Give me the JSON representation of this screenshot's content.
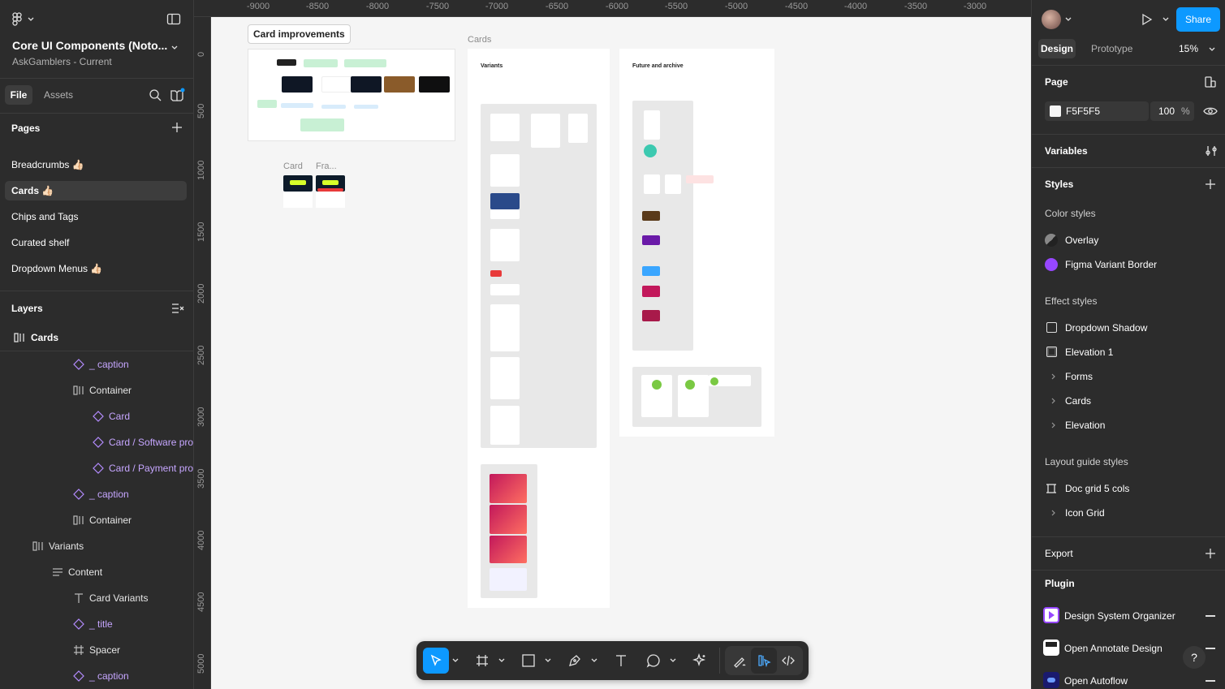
{
  "left_panel": {
    "file_name": "Core UI Components (Noto...",
    "project": "AskGamblers - Current",
    "tabs": {
      "file": "File",
      "assets": "Assets"
    },
    "pages_header": "Pages",
    "pages": [
      "Breadcrumbs 👍🏻",
      "Cards 👍🏻",
      "Chips and Tags",
      "Curated shelf",
      "Dropdown Menus 👍🏻"
    ],
    "layers_header": "Layers",
    "layers_root": "Cards",
    "layers": [
      {
        "label": "_ caption",
        "icon": "component-instance-icon",
        "purple": true
      },
      {
        "label": "Container",
        "icon": "frame-autolayout-icon",
        "purple": false
      },
      {
        "label": "Card",
        "icon": "component-instance-icon",
        "purple": true
      },
      {
        "label": "Card / Software pro",
        "icon": "component-instance-icon",
        "purple": true
      },
      {
        "label": "Card / Payment prov",
        "icon": "component-instance-icon",
        "purple": true
      },
      {
        "label": "_ caption",
        "icon": "component-instance-icon",
        "purple": true
      },
      {
        "label": "Container",
        "icon": "frame-autolayout-icon",
        "purple": false
      },
      {
        "label": "Variants",
        "icon": "frame-autolayout-icon",
        "purple": false
      },
      {
        "label": "Content",
        "icon": "autolayout-vertical-icon",
        "purple": false
      },
      {
        "label": "Card Variants",
        "icon": "text-icon",
        "purple": false
      },
      {
        "label": "_ title",
        "icon": "component-instance-icon",
        "purple": true
      },
      {
        "label": "Spacer",
        "icon": "frame-hash-icon",
        "purple": false
      },
      {
        "label": "_ caption",
        "icon": "component-instance-icon",
        "purple": true
      }
    ]
  },
  "canvas": {
    "ruler_x": [
      "-9000",
      "-8500",
      "-8000",
      "-7500",
      "-7000",
      "-6500",
      "-6000",
      "-5500",
      "-5000",
      "-4500",
      "-4000",
      "-3500",
      "-3000"
    ],
    "ruler_y": [
      "0",
      "500",
      "1000",
      "1500",
      "2000",
      "2500",
      "3000",
      "3500",
      "4000",
      "4500",
      "5000"
    ],
    "improvements_label": "Card improvements",
    "cards_section_label": "Cards",
    "card_label": "Card",
    "frame_label": "Fra...",
    "variants_title": "Variants",
    "future_title": "Future and archive"
  },
  "right_panel": {
    "tabs": {
      "design": "Design",
      "prototype": "Prototype"
    },
    "zoom": "15%",
    "share": "Share",
    "page_header": "Page",
    "page_color": "F5F5F5",
    "page_opacity": "100",
    "percent": "%",
    "variables": "Variables",
    "styles": "Styles",
    "color_styles_header": "Color styles",
    "color_styles": [
      {
        "name": "Overlay",
        "swatch": "#555555"
      },
      {
        "name": "Figma Variant Border",
        "swatch": "#9747ff"
      }
    ],
    "effect_styles_header": "Effect styles",
    "effect_styles": [
      "Dropdown Shadow",
      "Elevation 1"
    ],
    "effect_groups": [
      "Forms",
      "Cards",
      "Elevation"
    ],
    "layout_guide_header": "Layout guide styles",
    "layout_guides": [
      "Doc grid 5 cols"
    ],
    "layout_groups": [
      "Icon Grid"
    ],
    "export": "Export",
    "plugin": "Plugin",
    "plugins": [
      "Design System Organizer",
      "Open Annotate Design",
      "Open Autoflow"
    ],
    "help": "?"
  },
  "colors": {
    "accent": "#0d99ff",
    "panel": "#2c2c2c",
    "canvas": "#f5f5f5",
    "purple": "#c6a6ff"
  }
}
